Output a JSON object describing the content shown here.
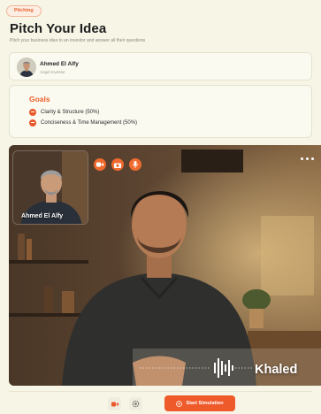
{
  "header": {
    "badge": "Pitching",
    "title": "Pitch Your Idea",
    "subtitle": "Pitch your business idea to an investor and answer all their questions"
  },
  "investor": {
    "name": "Ahmed El Alfy",
    "role": "Angel Investor"
  },
  "goals": {
    "title": "Goals",
    "items": [
      {
        "label": "Clarity & Structure (50%)"
      },
      {
        "label": "Conciseness & Time Management (50%)"
      }
    ]
  },
  "video": {
    "pip_name": "Ahmed El Alfy",
    "speaker_name": "Khaled",
    "controls": [
      "video-icon",
      "camera-icon",
      "microphone-icon"
    ],
    "menu_icon": "more-icon"
  },
  "footer": {
    "start_label": "Start Simulation"
  },
  "colors": {
    "accent": "#ee5a2a",
    "background": "#f7f5e6"
  }
}
